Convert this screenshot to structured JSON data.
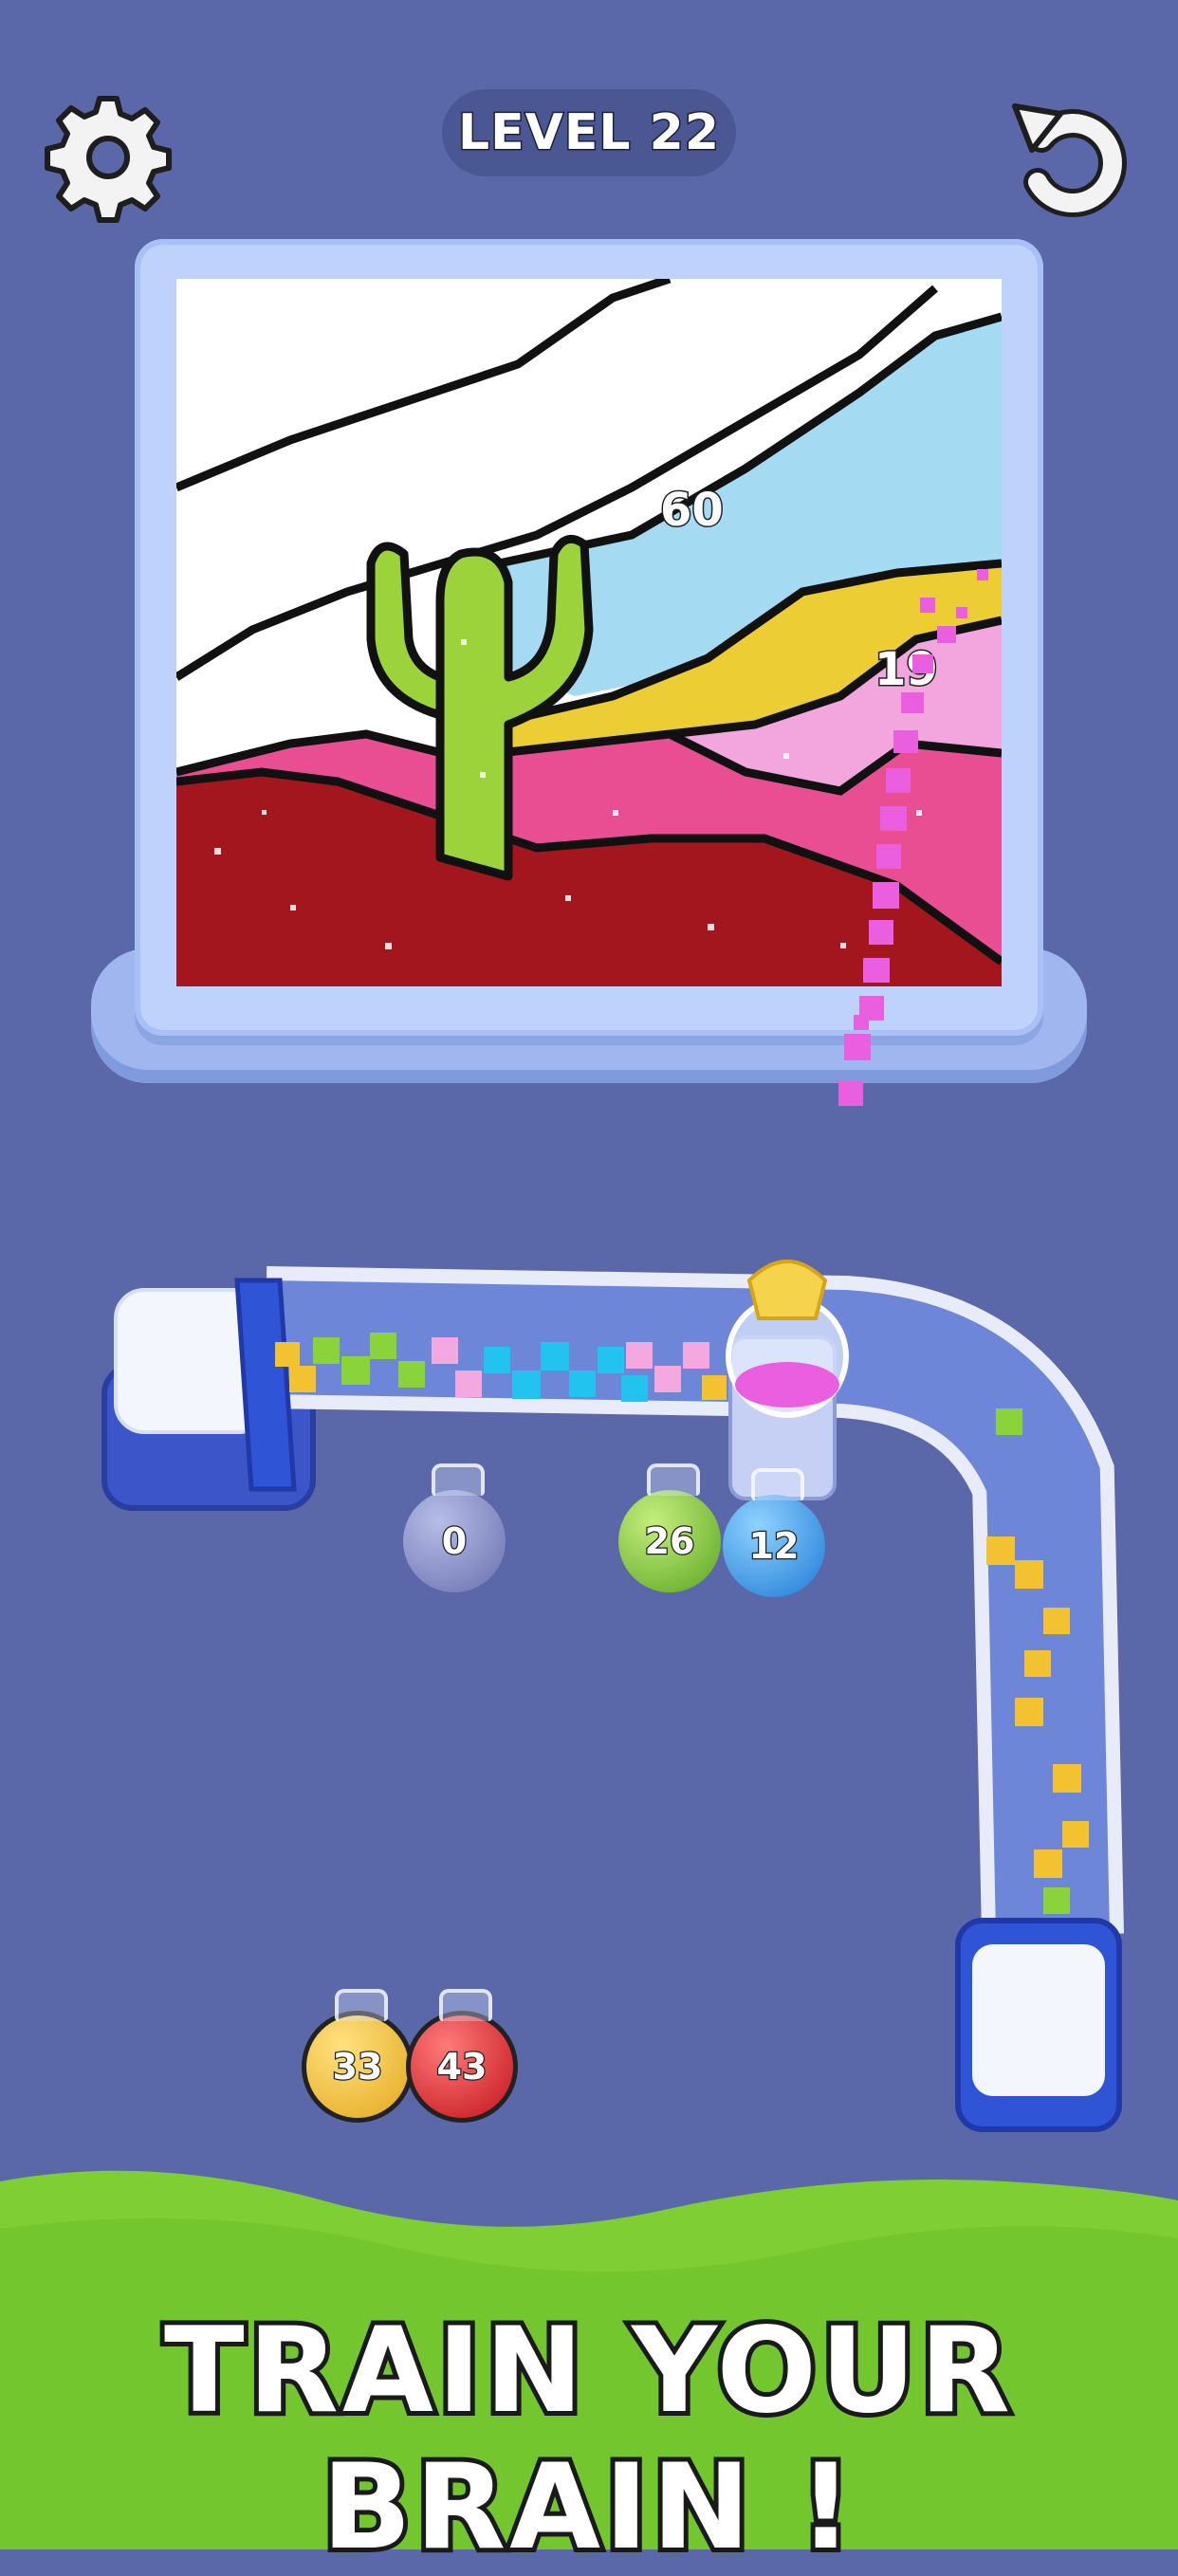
{
  "header": {
    "level_text": "LEVEL 22",
    "settings_icon": "gear-icon",
    "restart_icon": "restart-arrow-icon"
  },
  "canvas": {
    "region_labels": [
      "60",
      "19"
    ],
    "colors": {
      "sky": "#a5dbf2",
      "yellow": "#eccd33",
      "pink": "#f3a6dd",
      "magenta": "#e94d92",
      "red": "#a3161e",
      "cactus": "#9cd23a",
      "white": "#ffffff"
    }
  },
  "conveyor_jars": [
    {
      "count": "0",
      "color": "#8c93c7"
    },
    {
      "count": "26",
      "color": "#8bd33a"
    },
    {
      "count": "12",
      "color": "#2a9cf0"
    }
  ],
  "queued_jars": [
    {
      "count": "33",
      "color": "#f0c22e"
    },
    {
      "count": "43",
      "color": "#e2272e"
    }
  ],
  "footer": {
    "slogan": "TRAIN YOUR BRAIN !"
  }
}
